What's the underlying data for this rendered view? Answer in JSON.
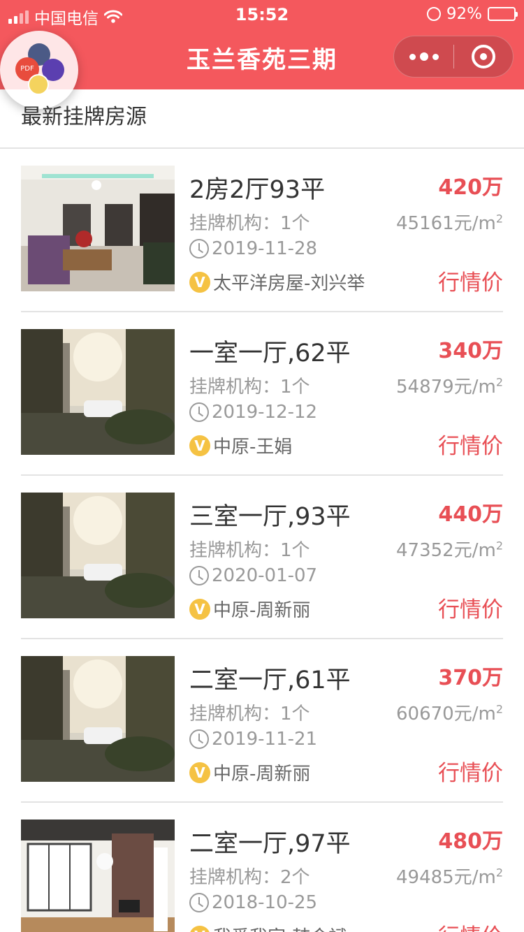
{
  "status_bar": {
    "carrier": "中国电信",
    "time": "15:52",
    "battery": "92%"
  },
  "nav": {
    "title": "玉兰香苑三期"
  },
  "float_bubble": {
    "badge_text": "PDF"
  },
  "section": {
    "title": "最新挂牌房源"
  },
  "listings": [
    {
      "title": "2房2厅93平",
      "price": "420万",
      "agency": "挂牌机构：1个",
      "unit_price": "45161元/m",
      "unit_sup": "2",
      "date": "2019-11-28",
      "agent": "太平洋房屋-刘兴举",
      "market_label": "行情价",
      "thumb": "living-room"
    },
    {
      "title": "一室一厅,62平",
      "price": "340万",
      "agency": "挂牌机构：1个",
      "unit_price": "54879元/m",
      "unit_sup": "2",
      "date": "2019-12-12",
      "agent": "中原-王娟",
      "market_label": "行情价",
      "thumb": "courtyard"
    },
    {
      "title": "三室一厅,93平",
      "price": "440万",
      "agency": "挂牌机构：1个",
      "unit_price": "47352元/m",
      "unit_sup": "2",
      "date": "2020-01-07",
      "agent": "中原-周新丽",
      "market_label": "行情价",
      "thumb": "courtyard"
    },
    {
      "title": "二室一厅,61平",
      "price": "370万",
      "agency": "挂牌机构：1个",
      "unit_price": "60670元/m",
      "unit_sup": "2",
      "date": "2019-11-21",
      "agent": "中原-周新丽",
      "market_label": "行情价",
      "thumb": "courtyard"
    },
    {
      "title": "二室一厅,97平",
      "price": "480万",
      "agency": "挂牌机构：2个",
      "unit_price": "49485元/m",
      "unit_sup": "2",
      "date": "2018-10-25",
      "agent": "我爱我家-韩金斌",
      "market_label": "行情价",
      "thumb": "loft"
    }
  ],
  "colors": {
    "nav_bg": "#f4585d",
    "price": "#e84f55",
    "muted": "#999999",
    "badge": "#f5c243"
  }
}
